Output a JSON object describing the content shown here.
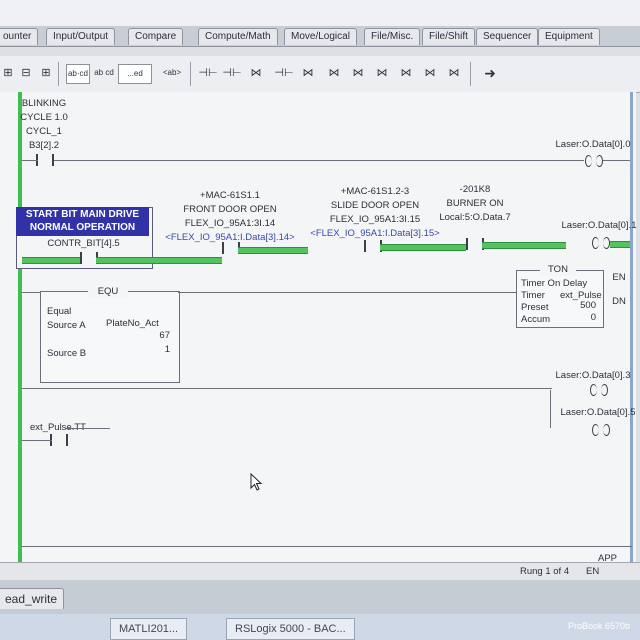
{
  "tabs": [
    "ounter",
    "Input/Output",
    "Compare",
    "Compute/Math",
    "Move/Logical",
    "File/Misc.",
    "File/Shift",
    "Sequencer",
    "Equipment"
  ],
  "toolbar": {
    "box1": "ab·cd",
    "box2": "ab cd",
    "box3": "...ed",
    "box4": "<ab>"
  },
  "rung0": {
    "label_lines": [
      "BLINKING",
      "CYCLE 1.0",
      "CYCL_1",
      "B3[2].2"
    ],
    "output": "Laser:O.Data[0].0"
  },
  "rung1": {
    "desc_title": "START BIT MAIN DRIVE NORMAL OPERATION",
    "desc_tag": "CONTR_BIT[4].5",
    "contact1_lines": [
      "+MAC-61S1.1",
      "FRONT DOOR OPEN",
      "FLEX_IO_95A1:3I.14",
      "<FLEX_IO_95A1:I.Data[3].14>"
    ],
    "contact2_lines": [
      "+MAC-61S1.2-3",
      "SLIDE DOOR OPEN",
      "FLEX_IO_95A1:3I.15",
      "<FLEX_IO_95A1:I.Data[3].15>"
    ],
    "contact3_lines": [
      "-201K8",
      "BURNER ON",
      "Local:5:O.Data.7"
    ],
    "output": "Laser:O.Data[0].1"
  },
  "rung2": {
    "equ_title": "EQU",
    "equ_name": "Equal",
    "source_a_label": "Source A",
    "source_a_tag": "PlateNo_Act",
    "source_a_value": "67",
    "source_b_label": "Source B",
    "source_b_value": "1",
    "ton_title": "TON",
    "ton_name": "Timer On Delay",
    "timer_label": "Timer",
    "timer_tag": "ext_Pulse",
    "preset_label": "Preset",
    "preset_value": "500",
    "accum_label": "Accum",
    "accum_value": "0",
    "en": "EN",
    "dn": "DN"
  },
  "rung3": {
    "input": "ext_Pulse.TT",
    "output1": "Laser:O.Data[0].3",
    "output2": "Laser:O.Data[0].5"
  },
  "status": {
    "rung": "Rung 1 of 4",
    "app": "APP",
    "en": "EN"
  },
  "routine_tab": "ead_write",
  "taskbar": [
    "MATLI201...",
    "RSLogix 5000 - BAC..."
  ],
  "laptop_label": "ProBook 6570b"
}
